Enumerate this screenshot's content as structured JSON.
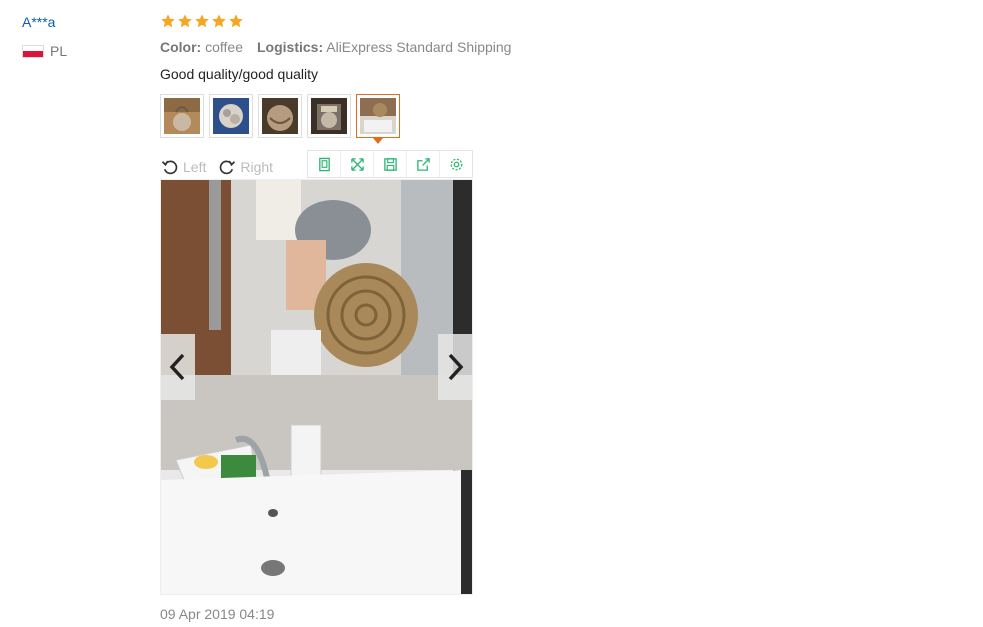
{
  "reviewer": {
    "name": "A***a",
    "country": "PL"
  },
  "rating": {
    "stars": 5,
    "max": 5,
    "star_color": "#f5a623"
  },
  "attributes": [
    {
      "key": "Color:",
      "value": "coffee"
    },
    {
      "key": "Logistics:",
      "value": "AliExpress Standard Shipping"
    }
  ],
  "review": {
    "text": "Good quality/good quality",
    "date": "09 Apr 2019 04:19"
  },
  "thumbnails": {
    "count": 5,
    "active_index": 4,
    "active_border_color": "#e66a1c"
  },
  "viewer": {
    "rotate_left_label": "Left",
    "rotate_right_label": "Right",
    "tools": [
      "original-size-icon",
      "fullscreen-icon",
      "save-icon",
      "share-icon",
      "settings-icon"
    ],
    "tool_color": "#2bb673"
  }
}
